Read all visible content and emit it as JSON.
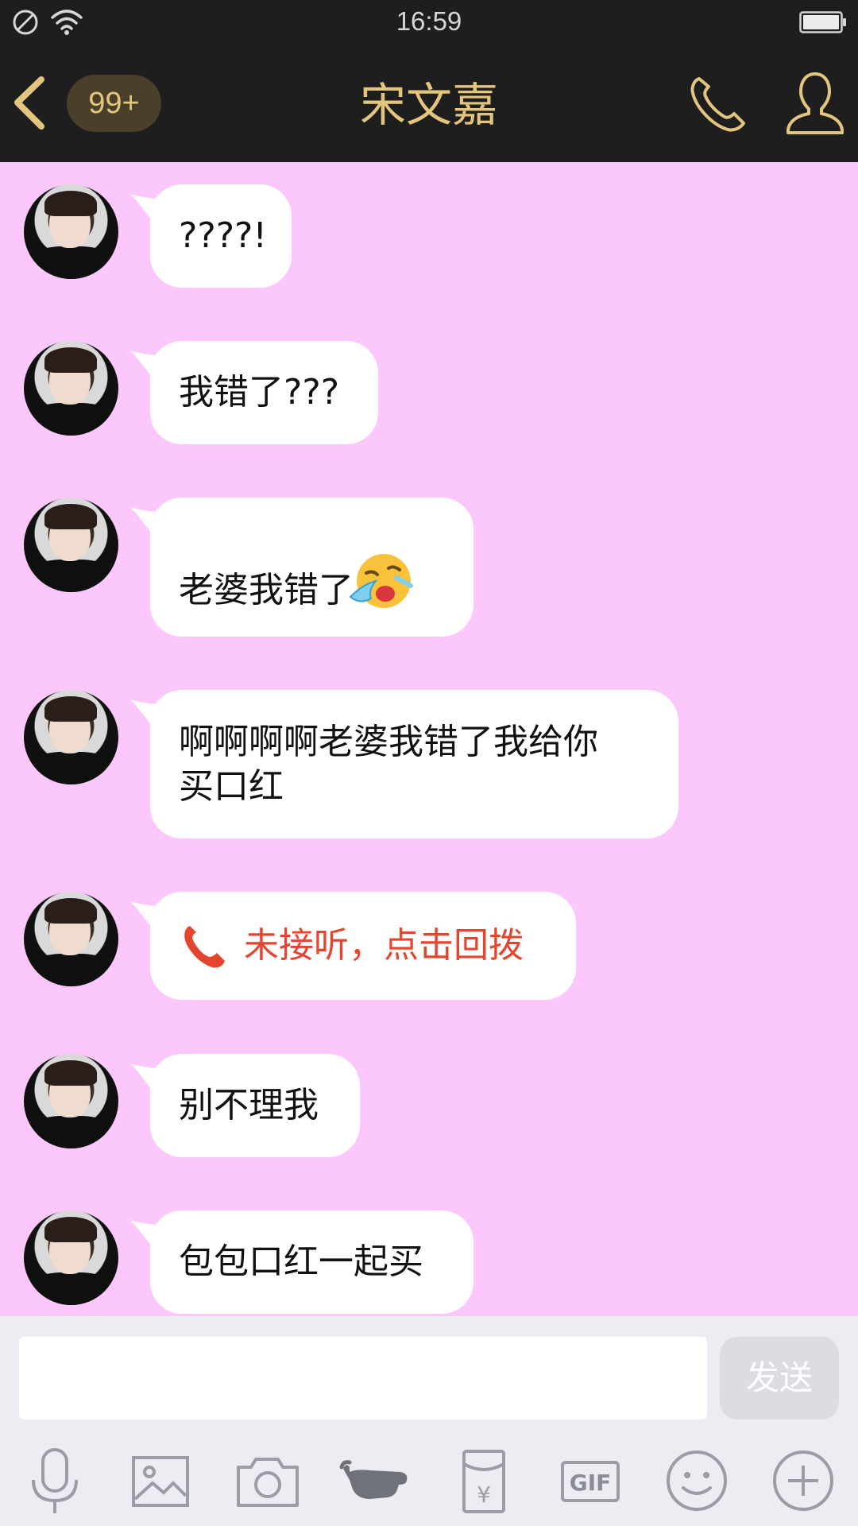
{
  "status_bar": {
    "time": "16:59"
  },
  "header": {
    "badge": "99+",
    "title": "宋文嘉"
  },
  "messages": [
    {
      "text": "????!"
    },
    {
      "text": "我错了???"
    },
    {
      "text": "老婆我错了",
      "emoji": "loudly-crying-emoji"
    },
    {
      "line1": "啊啊啊啊老婆我错了我给你",
      "line2": "买口红"
    },
    {
      "text": "未接听，点击回拨",
      "type": "missed-call"
    },
    {
      "text": "别不理我"
    },
    {
      "text": "包包口红一起买"
    }
  ],
  "input": {
    "value": "",
    "placeholder": "",
    "send_label": "发送"
  },
  "toolbar": {
    "icons": [
      "microphone-icon",
      "image-icon",
      "camera-icon",
      "poke-hand-icon",
      "red-packet-icon",
      "gif-icon",
      "emoji-icon",
      "plus-icon"
    ],
    "gif_label": "GIF",
    "yuan_label": "¥"
  },
  "colors": {
    "chat_background": "#fcc8fc",
    "header_background": "#1e1e1e",
    "accent_gold": "#e4c57d",
    "missed_call_red": "#e4452e"
  }
}
